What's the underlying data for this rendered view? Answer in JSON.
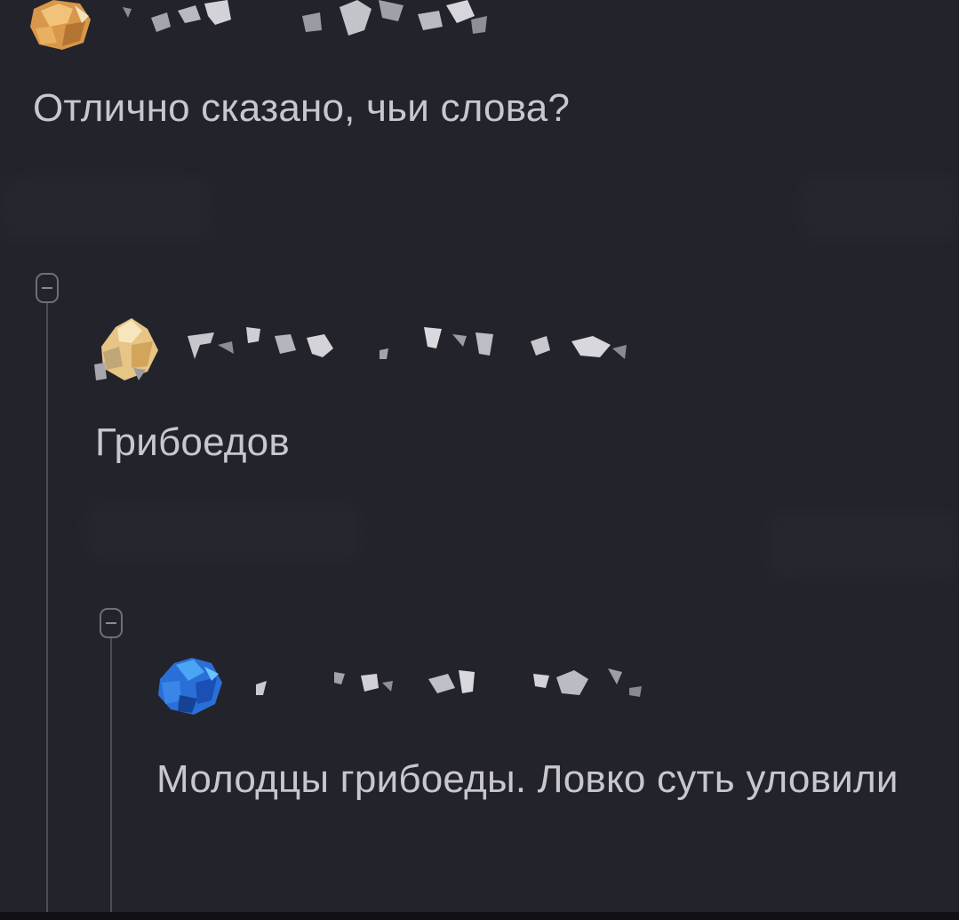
{
  "comments": [
    {
      "text": "Отлично сказано, чьи слова?",
      "avatar_color": "#e7a54a"
    },
    {
      "text": "Грибоедов",
      "avatar_color": "#e9c98b"
    },
    {
      "text": "Молодцы грибоеды. Ловко суть уловили",
      "avatar_color": "#2f6fd6"
    }
  ],
  "colors": {
    "background": "#23232b",
    "text": "#c7c7cd",
    "thread_line": "#4d4d55"
  }
}
